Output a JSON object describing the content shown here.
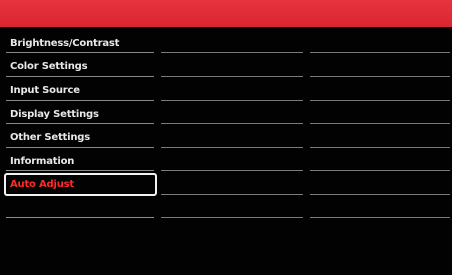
{
  "menu": {
    "items": [
      {
        "label": "Brightness/Contrast",
        "selected": false
      },
      {
        "label": "Color Settings",
        "selected": false
      },
      {
        "label": "Input Source",
        "selected": false
      },
      {
        "label": "Display Settings",
        "selected": false
      },
      {
        "label": "Other Settings",
        "selected": false
      },
      {
        "label": "Information",
        "selected": false
      },
      {
        "label": "Auto Adjust",
        "selected": true
      }
    ]
  },
  "colors": {
    "accent_bar": "#e02b35",
    "background": "#020202",
    "selected_text": "#ff2a2a",
    "text": "#e8e8e8"
  }
}
